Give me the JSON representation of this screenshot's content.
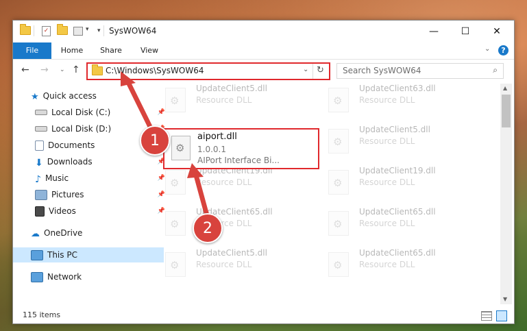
{
  "window": {
    "title": "SysWOW64",
    "accent": "#1979ca"
  },
  "ribbon": {
    "tabs": [
      "File",
      "Home",
      "Share",
      "View"
    ]
  },
  "address": {
    "path": "C:\\Windows\\SysWOW64",
    "search_placeholder": "Search SysWOW64"
  },
  "nav": {
    "items": [
      {
        "label": "Quick access",
        "icon": "star-icon"
      },
      {
        "label": "Local Disk (C:)",
        "icon": "drive-icon",
        "pinned": true
      },
      {
        "label": "Local Disk (D:)",
        "icon": "drive-icon",
        "pinned": true
      },
      {
        "label": "Documents",
        "icon": "documents-icon",
        "pinned": true
      },
      {
        "label": "Downloads",
        "icon": "downloads-icon",
        "pinned": true
      },
      {
        "label": "Music",
        "icon": "music-icon",
        "pinned": true
      },
      {
        "label": "Pictures",
        "icon": "pictures-icon",
        "pinned": true
      },
      {
        "label": "Videos",
        "icon": "videos-icon",
        "pinned": true
      },
      {
        "label": "OneDrive",
        "icon": "cloud-icon"
      },
      {
        "label": "This PC",
        "icon": "computer-icon",
        "selected": true
      },
      {
        "label": "Network",
        "icon": "network-icon"
      }
    ]
  },
  "files": [
    {
      "name": "UpdateClient5.dll",
      "type": "Resource DLL"
    },
    {
      "name": "UpdateClient63.dll",
      "type": "Resource DLL"
    },
    {
      "name": "UpdateClient5.dll",
      "type": "Resource DLL"
    },
    {
      "name": "UpdateClient19.dll",
      "type": "Resource DLL"
    },
    {
      "name": "UpdateClient19.dll",
      "type": "Resource DLL"
    },
    {
      "name": "UpdateClient65.dll",
      "type": "Resource DLL"
    },
    {
      "name": "UpdateClient65.dll",
      "type": "Resource DLL"
    },
    {
      "name": "UpdateClient5.dll",
      "type": "Resource DLL"
    },
    {
      "name": "UpdateClient65.dll",
      "type": "Resource DLL"
    }
  ],
  "highlight": {
    "name": "aiport.dll",
    "version": "1.0.0.1",
    "description": "AIPort Interface Bi..."
  },
  "annotations": {
    "step1": "1",
    "step2": "2",
    "color": "#d8433d"
  },
  "status": {
    "count": "115 items"
  }
}
